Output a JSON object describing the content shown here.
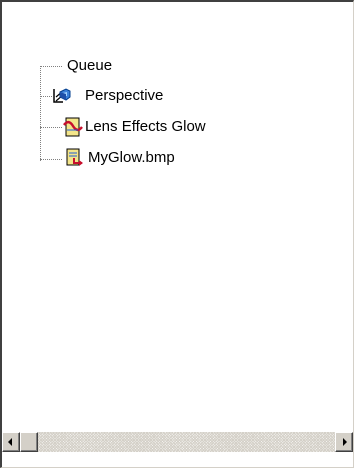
{
  "tree": {
    "root": {
      "label": "Queue"
    },
    "items": [
      {
        "label": "Perspective",
        "icon": "perspective-camera-icon"
      },
      {
        "label": "Lens Effects Glow",
        "icon": "lens-effect-filter-icon"
      },
      {
        "label": "MyGlow.bmp",
        "icon": "image-output-icon"
      }
    ]
  },
  "scrollbar": {
    "orientation": "horizontal",
    "position": 0
  },
  "colors": {
    "panel_background": "#ffffff",
    "chrome": "#d4d0c8",
    "icon_yellow": "#f3e58a",
    "icon_red": "#c8102e",
    "icon_blue": "#1f5fd6"
  }
}
